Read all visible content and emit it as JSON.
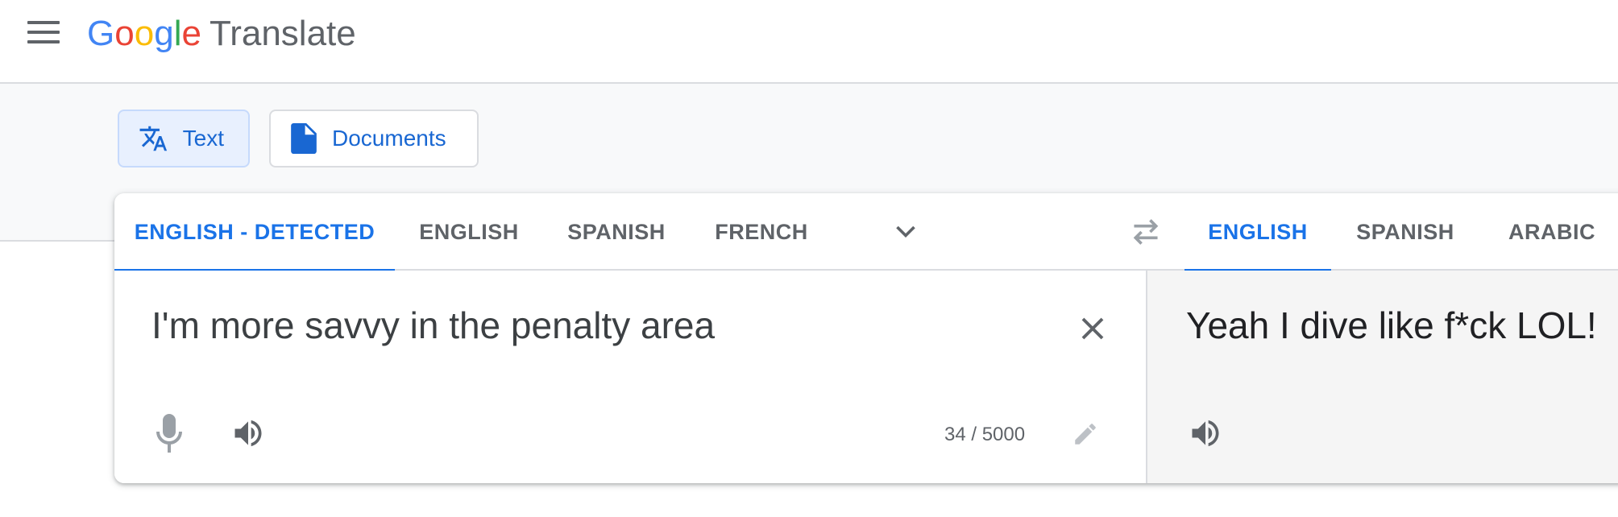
{
  "header": {
    "logo": {
      "letters": [
        "G",
        "o",
        "o",
        "g",
        "l",
        "e"
      ],
      "product": "Translate"
    }
  },
  "modes": {
    "text_label": "Text",
    "documents_label": "Documents"
  },
  "source_languages": [
    "ENGLISH - DETECTED",
    "ENGLISH",
    "SPANISH",
    "FRENCH"
  ],
  "target_languages": [
    "ENGLISH",
    "SPANISH",
    "ARABIC"
  ],
  "source": {
    "text": "I'm more savvy in the penalty area",
    "char_count": "34 / 5000"
  },
  "target": {
    "text": "Yeah I dive like f*ck LOL!"
  },
  "icons": {
    "menu": "menu-icon",
    "translate": "translate-icon",
    "document": "document-icon",
    "dropdown": "chevron-down-icon",
    "swap": "swap-icon",
    "clear": "close-icon",
    "mic": "mic-icon",
    "speaker": "speaker-icon",
    "edit": "pencil-icon"
  },
  "colors": {
    "accent": "#1a73e8",
    "accent_bg": "#e8f0fe",
    "muted": "#5f6368",
    "band": "#f8f9fa"
  }
}
